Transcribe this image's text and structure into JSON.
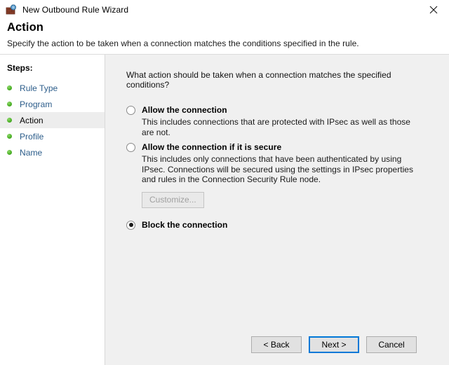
{
  "window": {
    "title": "New Outbound Rule Wizard",
    "icon": "firewall-globe-icon",
    "close_label": "✕"
  },
  "header": {
    "title": "Action",
    "subtitle": "Specify the action to be taken when a connection matches the conditions specified in the rule."
  },
  "sidebar": {
    "heading": "Steps:",
    "items": [
      {
        "label": "Rule Type",
        "active": false
      },
      {
        "label": "Program",
        "active": false
      },
      {
        "label": "Action",
        "active": true
      },
      {
        "label": "Profile",
        "active": false
      },
      {
        "label": "Name",
        "active": false
      }
    ]
  },
  "main": {
    "question": "What action should be taken when a connection matches the specified conditions?",
    "options": [
      {
        "title": "Allow the connection",
        "description": "This includes connections that are protected with IPsec as well as those are not.",
        "selected": false
      },
      {
        "title": "Allow the connection if it is secure",
        "description": "This includes only connections that have been authenticated by using IPsec.  Connections will be secured using the settings in IPsec properties and rules in the Connection Security Rule node.",
        "selected": false,
        "customize_label": "Customize...",
        "customize_disabled": true
      },
      {
        "title": "Block the connection",
        "description": "",
        "selected": true
      }
    ]
  },
  "footer": {
    "back_label": "< Back",
    "next_label": "Next >",
    "cancel_label": "Cancel"
  },
  "colors": {
    "accent": "#0078d7",
    "link": "#2b5c8a",
    "content_bg": "#f0f0f0",
    "step_bullet": "#4fb32a"
  }
}
